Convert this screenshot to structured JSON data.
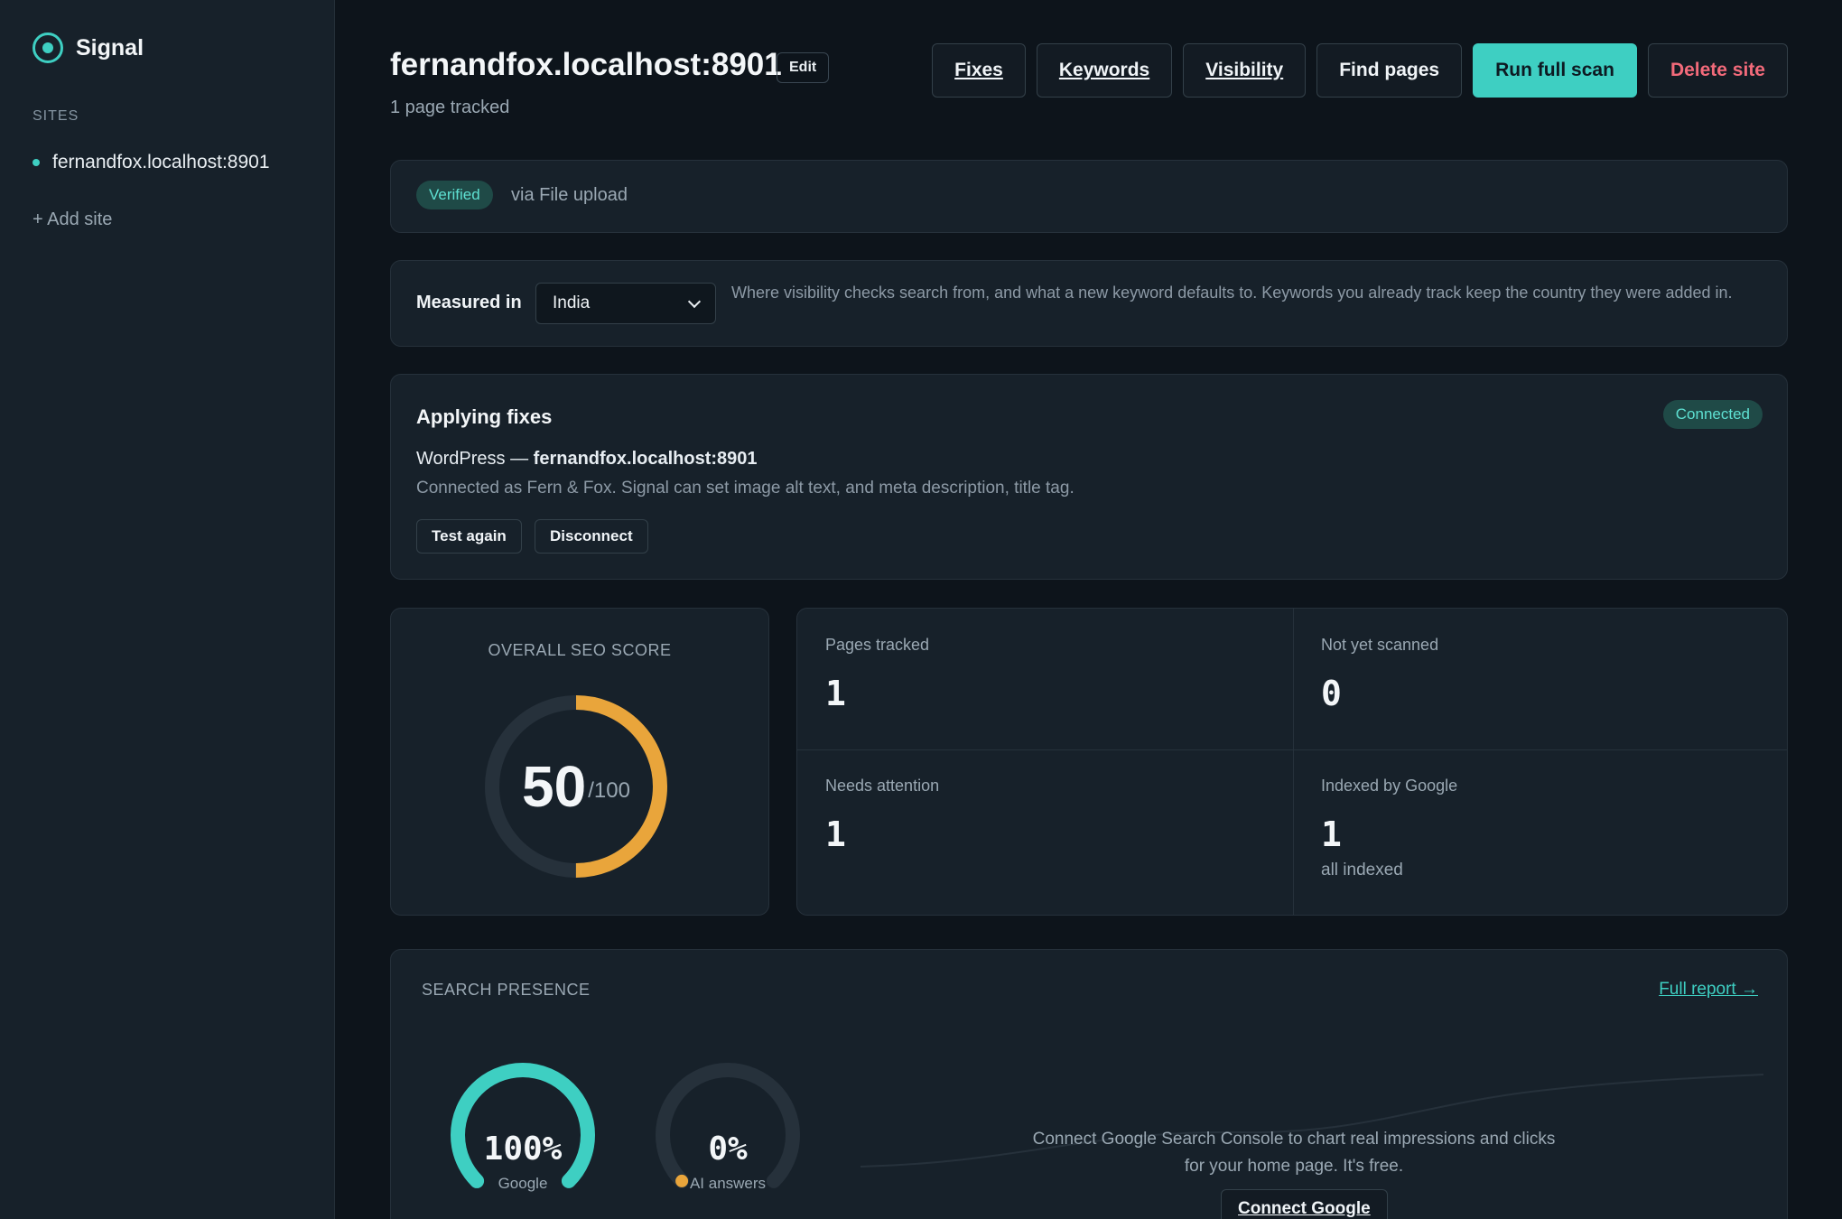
{
  "sidebar": {
    "brand": "Signal",
    "sites_heading": "SITES",
    "sites": [
      {
        "label": "fernandfox.localhost:8901"
      }
    ],
    "add_site": "+ Add site"
  },
  "header": {
    "title": "fernandfox.localhost:8901",
    "edit": "Edit",
    "subtitle": "1 page tracked",
    "buttons": {
      "fixes": "Fixes",
      "keywords": "Keywords",
      "visibility": "Visibility",
      "find_pages": "Find pages",
      "run_scan": "Run full scan",
      "delete_site": "Delete site"
    }
  },
  "verification": {
    "badge": "Verified",
    "method": "via File upload"
  },
  "measurement": {
    "label": "Measured in",
    "country": "India",
    "help": "Where visibility checks search from, and what a new keyword defaults to. Keywords you already track keep the country they were added in."
  },
  "fixes": {
    "title": "Applying fixes",
    "status": "Connected",
    "platform": "WordPress —",
    "site": "fernandfox.localhost:8901",
    "description": "Connected as Fern & Fox. Signal can set image alt text, and meta description, title tag.",
    "test_again": "Test again",
    "disconnect": "Disconnect"
  },
  "seo_score": {
    "label": "OVERALL SEO SCORE",
    "score": "50",
    "max": "/100",
    "fraction": 0.5
  },
  "stats": {
    "pages_tracked": {
      "label": "Pages tracked",
      "value": "1"
    },
    "not_scanned": {
      "label": "Not yet scanned",
      "value": "0"
    },
    "needs_attention": {
      "label": "Needs attention",
      "value": "1"
    },
    "indexed": {
      "label": "Indexed by Google",
      "value": "1",
      "sub": "all indexed"
    }
  },
  "presence": {
    "title": "SEARCH PRESENCE",
    "full_report": "Full report →",
    "google": {
      "value": "100%",
      "label": "Google",
      "fraction": 1.0
    },
    "ai": {
      "value": "0%",
      "label": "AI answers",
      "fraction": 0.0
    },
    "connect_text": "Connect Google Search Console to chart real impressions and clicks for your home page. It's free.",
    "connect_button": "Connect Google"
  },
  "colors": {
    "accent": "#3ecfc2",
    "score": "#e9a53b",
    "danger": "#f26a7a",
    "background": "#0d141b",
    "panel": "#17212a"
  }
}
